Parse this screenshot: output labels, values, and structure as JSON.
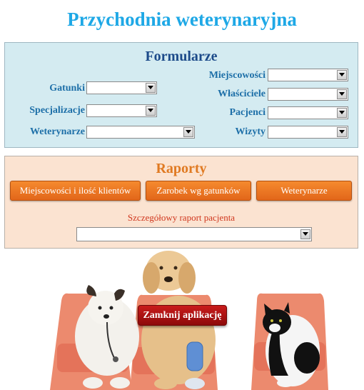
{
  "app": {
    "title": "Przychodnia weterynaryjna"
  },
  "forms": {
    "heading": "Formularze",
    "left": [
      {
        "label": "Gatunki",
        "value": ""
      },
      {
        "label": "Specjalizacje",
        "value": ""
      },
      {
        "label": "Weterynarze",
        "value": ""
      }
    ],
    "right": [
      {
        "label": "Miejscowości",
        "value": ""
      },
      {
        "label": "Właściciele",
        "value": ""
      },
      {
        "label": "Pacjenci",
        "value": ""
      },
      {
        "label": "Wizyty",
        "value": ""
      }
    ]
  },
  "reports": {
    "heading": "Raporty",
    "buttons": [
      "Miejscowości i ilość klientów",
      "Zarobek wg gatunków",
      "Weterynarze"
    ],
    "detail_label": "Szczegółowy raport pacjenta",
    "detail_value": ""
  },
  "close_button": "Zamknij aplikację",
  "colors": {
    "title": "#1ea8e6",
    "forms_heading": "#1d4b8a",
    "reports_heading": "#e07a22",
    "button": "#ee7b24",
    "close": "#b01414"
  }
}
